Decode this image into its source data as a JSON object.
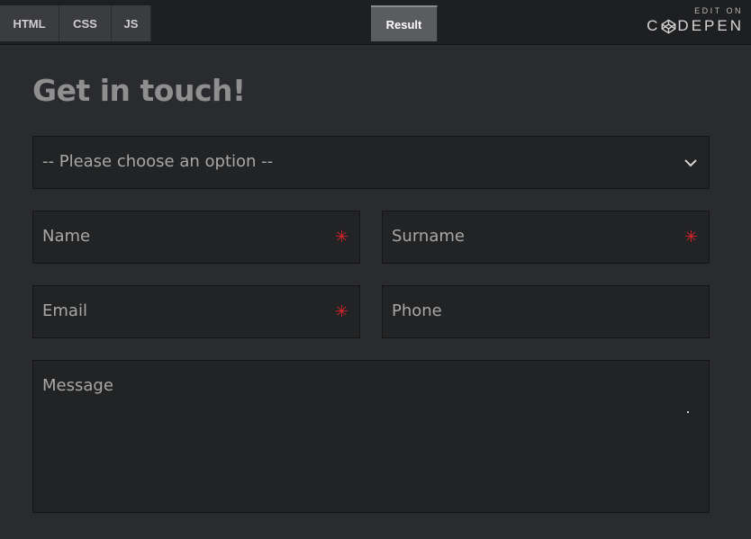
{
  "tabs": [
    {
      "label": "HTML"
    },
    {
      "label": "CSS"
    },
    {
      "label": "JS"
    }
  ],
  "result_tab": {
    "label": "Result"
  },
  "branding": {
    "edit_on": "EDIT ON",
    "codepen_prefix": "C",
    "codepen_suffix": "DEPEN"
  },
  "form": {
    "title": "Get in touch!",
    "select": {
      "placeholder": "-- Please choose an option --",
      "icon": "chevron-down-icon"
    },
    "fields": {
      "name": {
        "placeholder": "Name",
        "required": true
      },
      "surname": {
        "placeholder": "Surname",
        "required": true
      },
      "email": {
        "placeholder": "Email",
        "required": true
      },
      "phone": {
        "placeholder": "Phone",
        "required": false
      },
      "message": {
        "placeholder": "Message"
      }
    },
    "required_marker": "✳",
    "colors": {
      "required": "#d9232b",
      "field_bg": "#222324",
      "page_bg": "#2a2b2e"
    }
  }
}
